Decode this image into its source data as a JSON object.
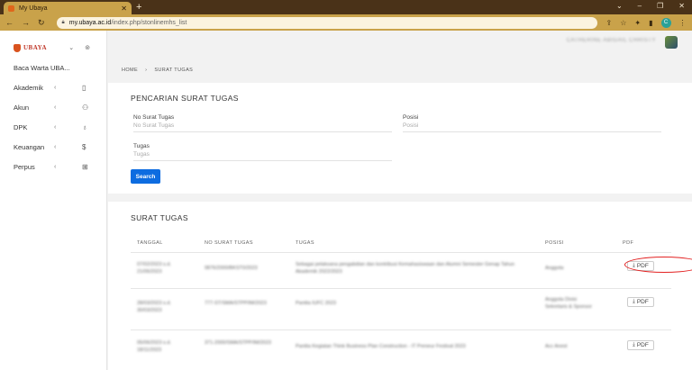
{
  "browser": {
    "tab_title": "My Ubaya",
    "tab_close": "✕",
    "new_tab": "+",
    "url_host": "my.ubaya.ac.id",
    "url_path": "/index.php/stonlinemhs_list",
    "profile_initial": "C"
  },
  "sidebar": {
    "logo_text": "UBAYA",
    "items": [
      {
        "label": "Baca Warta UBA..."
      },
      {
        "label": "Akademik"
      },
      {
        "label": "Akun"
      },
      {
        "label": "DPK"
      },
      {
        "label": "Keuangan"
      },
      {
        "label": "Perpus"
      }
    ]
  },
  "topbar": {
    "user_name": "CATHERINE ABIGAIL CHRISTY"
  },
  "breadcrumb": {
    "home": "HOME",
    "separator": "›",
    "current": "SURAT TUGAS"
  },
  "search_form": {
    "title": "PENCARIAN SURAT TUGAS",
    "fields": [
      {
        "label": "No Surat Tugas",
        "placeholder": "No Surat Tugas"
      },
      {
        "label": "Posisi",
        "placeholder": "Posisi"
      },
      {
        "label": "Tugas",
        "placeholder": "Tugas"
      }
    ],
    "button_label": "Search"
  },
  "results": {
    "title": "SURAT TUGAS",
    "columns": [
      "TANGGAL",
      "NO SURAT TUGAS",
      "TUGAS",
      "POSISI",
      "PDF"
    ],
    "rows": [
      {
        "tanggal": "07/02/2023 s.d. 21/06/2023",
        "no": "0876/2000/BKST0/2023",
        "tugas": "Sebagai pelaksana pengabdian dan kontribusi Kemahasiswaan dan Alumni Semester Genap Tahun Akademik 2022/2023",
        "posisi": "Anggota",
        "pdf": "PDF"
      },
      {
        "tanggal": "28/03/2023 s.d. 30/03/2023",
        "no": "777-ST/SMA/STPP/IM/2023",
        "tugas": "Panitia IUFC 2023",
        "posisi": "Anggota Divisi Sekretaris & Sponsor",
        "pdf": "PDF"
      },
      {
        "tanggal": "05/06/2023 s.d. 18/11/2023",
        "no": "371-2000/SMA/STPP/IM/2023",
        "tugas": "Panitia Kegiatan Think Business Plan Construction - IT Preneur Festival 2023",
        "posisi": "Acc Anest",
        "pdf": "PDF"
      }
    ]
  }
}
